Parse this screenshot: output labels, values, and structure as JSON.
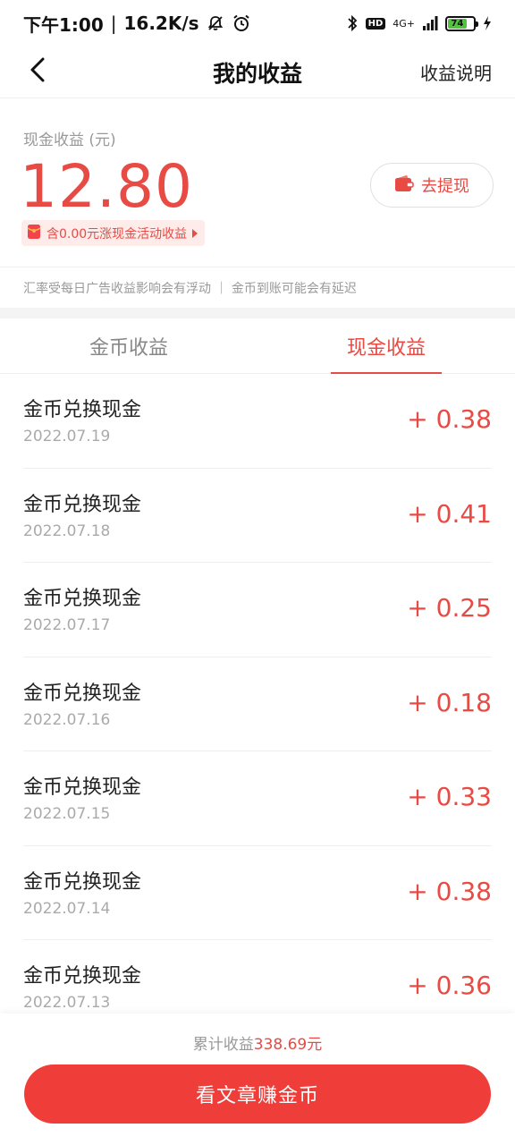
{
  "status_bar": {
    "time": "下午1:00",
    "speed": "16.2K/s",
    "hd": "HD",
    "network": "4G+",
    "battery": "74"
  },
  "nav": {
    "title": "我的收益",
    "right_link": "收益说明"
  },
  "earnings": {
    "label": "现金收益 (元)",
    "amount": "12.80",
    "withdraw_label": "去提现",
    "promo_text": "含0.00元涨现金活动收益"
  },
  "notice": "汇率受每日广告收益影响会有浮动 ｜ 金币到账可能会有延迟",
  "tabs": [
    {
      "label": "金币收益",
      "active": false
    },
    {
      "label": "现金收益",
      "active": true
    }
  ],
  "records": [
    {
      "title": "金币兑换现金",
      "date": "2022.07.19",
      "amount": "+ 0.38"
    },
    {
      "title": "金币兑换现金",
      "date": "2022.07.18",
      "amount": "+ 0.41"
    },
    {
      "title": "金币兑换现金",
      "date": "2022.07.17",
      "amount": "+ 0.25"
    },
    {
      "title": "金币兑换现金",
      "date": "2022.07.16",
      "amount": "+ 0.18"
    },
    {
      "title": "金币兑换现金",
      "date": "2022.07.15",
      "amount": "+ 0.33"
    },
    {
      "title": "金币兑换现金",
      "date": "2022.07.14",
      "amount": "+ 0.38"
    },
    {
      "title": "金币兑换现金",
      "date": "2022.07.13",
      "amount": "+ 0.36"
    }
  ],
  "footer": {
    "total_prefix": "累计收益",
    "total_value": "338.69元",
    "button_label": "看文章赚金币"
  },
  "colors": {
    "accent": "#e84a44",
    "button": "#ef3e3a",
    "battery": "#53c33f"
  },
  "icons": [
    "bell-off-icon",
    "alarm-icon",
    "bluetooth-icon",
    "signal-icon",
    "battery-icon",
    "charging-icon",
    "back-arrow-icon",
    "wallet-icon",
    "red-envelope-icon"
  ]
}
